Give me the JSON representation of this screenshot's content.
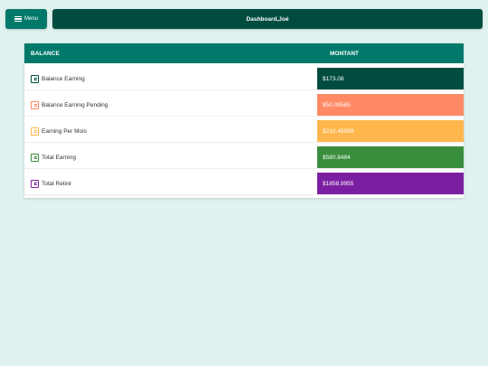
{
  "menu": {
    "label": "Menu"
  },
  "header": {
    "title": "Dashboard,Joé"
  },
  "table": {
    "headers": {
      "balance": "BALANCE",
      "montant": "MONTANT"
    },
    "rows": [
      {
        "label": "Balance Earning",
        "value": "$173.08",
        "color": "#004d40",
        "icon_color": "#004d40"
      },
      {
        "label": "Balance Earning Pending",
        "value": "$50.09585",
        "color": "#ff8a65",
        "icon_color": "#ff8a65"
      },
      {
        "label": "Earning Per Mois",
        "value": "$210.48599",
        "color": "#ffb74d",
        "icon_color": "#ffb74d"
      },
      {
        "label": "Total Earning",
        "value": "$580.8484",
        "color": "#388e3c",
        "icon_color": "#388e3c"
      },
      {
        "label": "Total Retiré",
        "value": "$1858.9955",
        "color": "#7b1fa2",
        "icon_color": "#7b1fa2"
      }
    ]
  }
}
